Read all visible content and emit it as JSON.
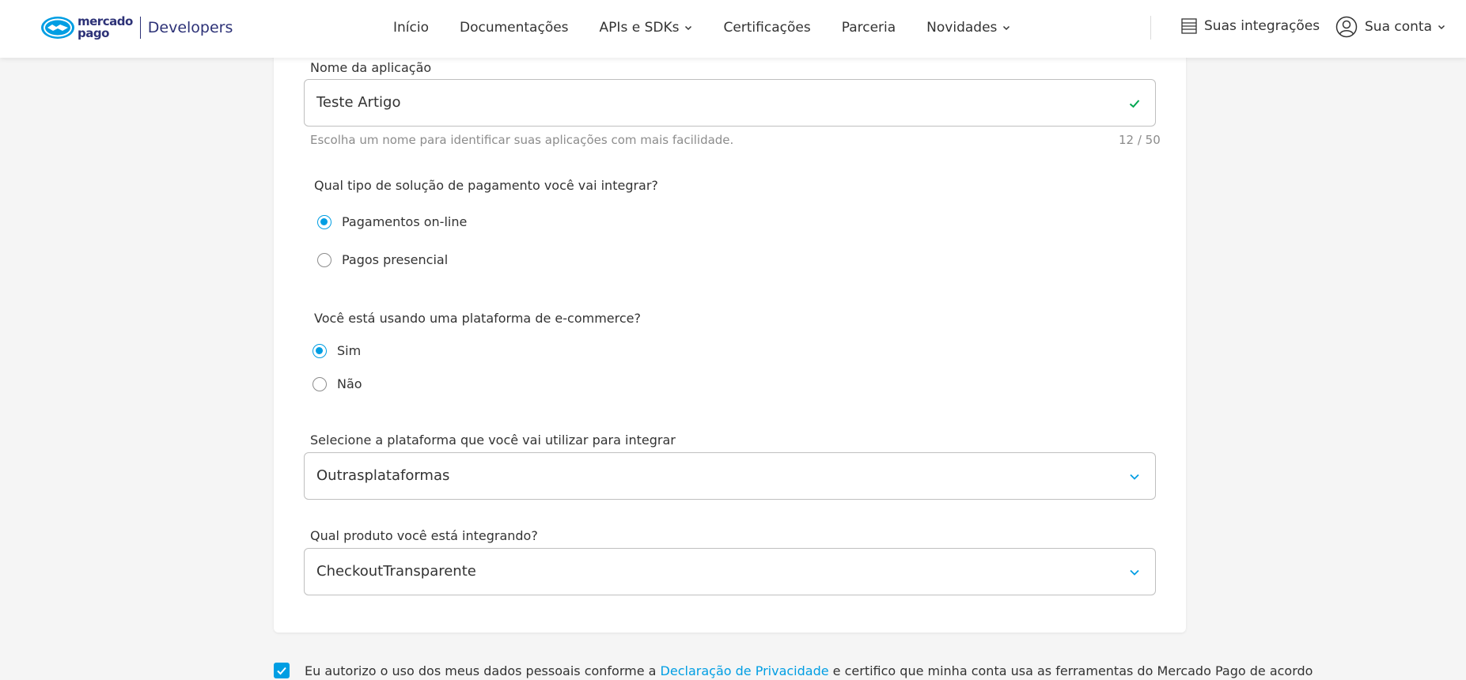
{
  "header": {
    "brand_line1": "mercado",
    "brand_line2": "pago",
    "brand_product": "Developers",
    "nav": [
      "Início",
      "Documentações",
      "APIs e SDKs",
      "Certificações",
      "Parceria",
      "Novidades"
    ],
    "integrations_label": "Suas integrações",
    "account_label": "Sua conta"
  },
  "form": {
    "app_name": {
      "label": "Nome da aplicação",
      "value": "Teste Artigo",
      "helper": "Escolha um nome para identificar suas aplicações com mais facilidade.",
      "counter": "12 / 50"
    },
    "payment_type": {
      "question": "Qual tipo de solução de pagamento você vai integrar?",
      "options": [
        "Pagamentos on-line",
        "Pagos presencial"
      ],
      "selected": "Pagamentos on-line"
    },
    "ecommerce": {
      "question": "Você está usando uma plataforma de e-commerce?",
      "options": [
        "Sim",
        "Não"
      ],
      "selected": "Sim"
    },
    "platform": {
      "label": "Selecione a plataforma que você vai utilizar para integrar",
      "value": "Outrasplataformas"
    },
    "product": {
      "label": "Qual produto você está integrando?",
      "value": "CheckoutTransparente"
    }
  },
  "consent": {
    "checked": true,
    "text_before": "Eu autorizo o uso dos meus dados pessoais conforme a ",
    "link": "Declaração de Privacidade",
    "text_after": " e certifico que minha conta usa as ferramentas do Mercado Pago de acordo"
  },
  "colors": {
    "accent": "#009ee3",
    "brand": "#2d3277",
    "success": "#00a650"
  }
}
